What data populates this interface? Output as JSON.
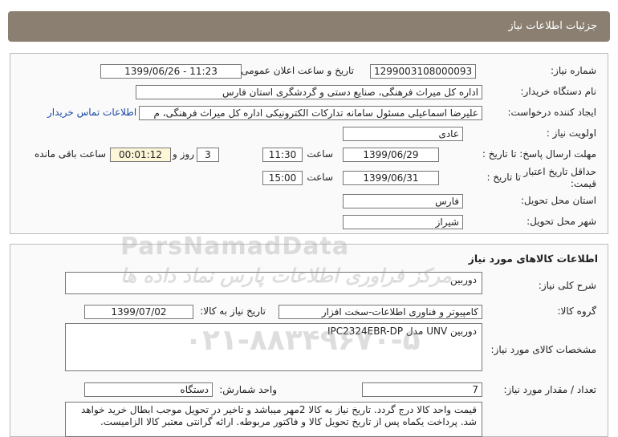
{
  "header": {
    "title": "جزئیات اطلاعات نیاز"
  },
  "need_info": {
    "need_number_label": "شماره نیاز:",
    "need_number": "1299003108000093",
    "announce_label": "تاریخ و ساعت اعلان عمومی:",
    "announce_value": "1399/06/26 - 11:23",
    "buyer_label": "نام دستگاه خریدار:",
    "buyer_value": "اداره کل میراث فرهنگی، صنایع دستی و گردشگری استان فارس",
    "creator_label": "ایجاد کننده درخواست:",
    "creator_value": "علیرضا اسماعیلی مسئول سامانه تدارکات الکترونیکی اداره کل میراث فرهنگی، م",
    "contact_link": "اطلاعات تماس خریدار",
    "priority_label": "اولویت نیاز :",
    "priority_value": "عادی",
    "reply_deadline_label": "مهلت ارسال پاسخ: تا تاریخ :",
    "reply_date": "1399/06/29",
    "time_label": "ساعت",
    "reply_time": "11:30",
    "days_value": "3",
    "days_label": "روز و",
    "remaining_value": "00:01:12",
    "remaining_label": "ساعت باقی مانده",
    "validity_label_1": "حداقل تاریخ اعتبار",
    "validity_label_2": "قیمت:",
    "validity_to_label": "تا تاریخ :",
    "validity_date": "1399/06/31",
    "validity_time_label": "ساعت",
    "validity_time": "15:00",
    "province_label": "استان محل تحویل:",
    "province_value": "فارس",
    "city_label": "شهر محل تحویل:",
    "city_value": "شیراز"
  },
  "goods": {
    "section_title": "اطلاعات کالاهای مورد نیاز",
    "desc_label": "شرح کلی نیاز:",
    "desc_value": "دوربین",
    "group_label": "گروه کالا:",
    "group_value": "کامپیوتر و فناوری اطلاعات-سخت افزار",
    "need_date_label": "تاریخ نیاز به کالا:",
    "need_date_value": "1399/07/02",
    "spec_label": "مشخصات کالای مورد نیاز:",
    "spec_value": "دوربین UNV مدل IPC2324EBR-DP",
    "qty_label": "تعداد / مقدار مورد نیاز:",
    "qty_value": "7",
    "unit_label": "واحد شمارش:",
    "unit_value": "دستگاه",
    "notes": "قیمت واحد کالا درج گردد. تاریخ نیاز به کالا 2مهر میباشد و تاخیر در تحویل موجب ابطال خرید خواهد شد. پرداخت یکماه پس از تاریخ تحویل کالا و فاکتور مربوطه. ارائه گرانتی معتبر کالا الزامیست."
  },
  "watermark": {
    "latin": "ParsNamadData",
    "persian": "مرکز فراوری اطلاعات پارس نماد داده ها",
    "phone": "۰۲۱-۸۸۳۴۹۶۷۰-۵"
  }
}
